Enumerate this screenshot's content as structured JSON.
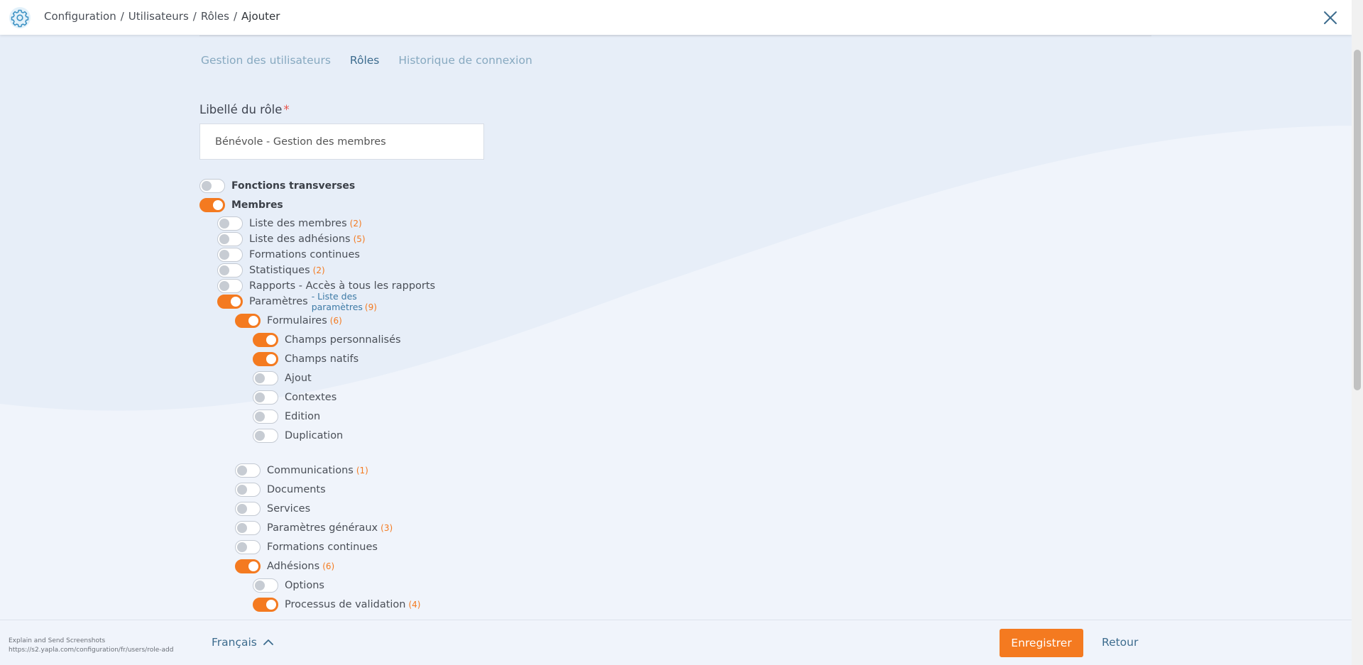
{
  "header": {
    "breadcrumb": [
      "Configuration",
      "Utilisateurs",
      "Rôles",
      "Ajouter"
    ],
    "separator": "/"
  },
  "tabs": [
    {
      "label": "Gestion des utilisateurs",
      "active": false
    },
    {
      "label": "Rôles",
      "active": true
    },
    {
      "label": "Historique de connexion",
      "active": false
    }
  ],
  "form": {
    "role_label": "Libellé du rôle",
    "required_mark": "*",
    "role_value": "Bénévole - Gestion des membres"
  },
  "permissions": [
    {
      "label": "Fonctions transverses",
      "on": false,
      "level": 0,
      "bold": true,
      "count": ""
    },
    {
      "label": "Membres",
      "on": true,
      "level": 0,
      "bold": true,
      "count": ""
    },
    {
      "label": "Liste des membres",
      "on": false,
      "level": 1,
      "count": "(2)"
    },
    {
      "label": "Liste des adhésions",
      "on": false,
      "level": 1,
      "count": "(5)"
    },
    {
      "label": "Formations continues",
      "on": false,
      "level": 1,
      "count": ""
    },
    {
      "label": "Statistiques",
      "on": false,
      "level": 1,
      "count": "(2)"
    },
    {
      "label": "Rapports - Accès à tous les rapports",
      "on": false,
      "level": 1,
      "count": ""
    },
    {
      "label": "Paramètres",
      "on": true,
      "level": 1,
      "count": "",
      "sub": "- Liste des paramètres",
      "sub_count": "(9)"
    },
    {
      "label": "Formulaires",
      "on": true,
      "level": 2,
      "count": "(6)"
    },
    {
      "label": "Champs personnalisés",
      "on": true,
      "level": 3,
      "count": ""
    },
    {
      "label": "Champs natifs",
      "on": true,
      "level": 3,
      "count": ""
    },
    {
      "label": "Ajout",
      "on": false,
      "level": 3,
      "count": ""
    },
    {
      "label": "Contextes",
      "on": false,
      "level": 3,
      "count": ""
    },
    {
      "label": "Edition",
      "on": false,
      "level": 3,
      "count": ""
    },
    {
      "label": "Duplication",
      "on": false,
      "level": 3,
      "count": ""
    },
    {
      "label": "Communications",
      "on": false,
      "level": 2,
      "count": "(1)"
    },
    {
      "label": "Documents",
      "on": false,
      "level": 2,
      "count": ""
    },
    {
      "label": "Services",
      "on": false,
      "level": 2,
      "count": ""
    },
    {
      "label": "Paramètres généraux",
      "on": false,
      "level": 2,
      "count": "(3)"
    },
    {
      "label": "Formations continues",
      "on": false,
      "level": 2,
      "count": ""
    },
    {
      "label": "Adhésions",
      "on": true,
      "level": 2,
      "count": "(6)"
    },
    {
      "label": "Options",
      "on": false,
      "level": 3,
      "count": ""
    },
    {
      "label": "Processus de validation",
      "on": true,
      "level": 3,
      "count": "(4)"
    }
  ],
  "footer": {
    "extension_title": "Explain and Send Screenshots",
    "extension_url": "https://s2.yapla.com/configuration/fr/users/role-add",
    "language": "Français",
    "save_label": "Enregistrer",
    "back_label": "Retour"
  },
  "colors": {
    "accent": "#f47a20",
    "link": "#3d6c8e",
    "tab_inactive": "#87a9c0"
  }
}
